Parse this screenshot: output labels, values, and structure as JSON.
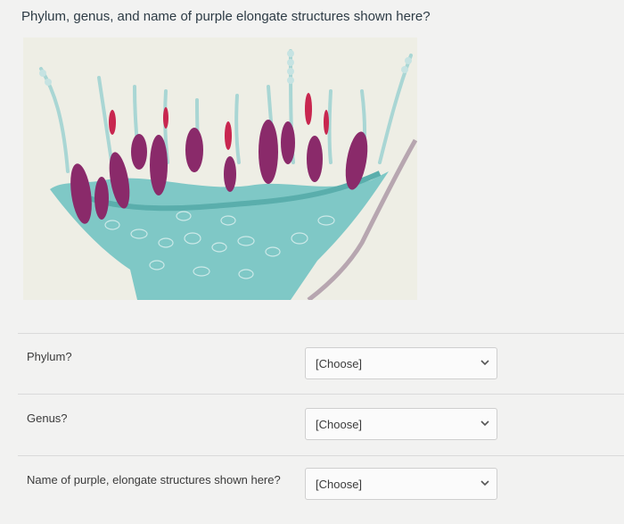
{
  "question": {
    "text": "Phylum, genus, and name of purple elongate structures shown here?"
  },
  "figure": {
    "icon": "micrograph-image",
    "colors": {
      "tissue": "#7fc8c6",
      "asci": "#8a2a6a",
      "background": "#eeeee5"
    }
  },
  "answers": [
    {
      "label": "Phylum?",
      "selected": "[Choose]"
    },
    {
      "label": "Genus?",
      "selected": "[Choose]"
    },
    {
      "label": "Name of purple, elongate structures shown here?",
      "selected": "[Choose]"
    }
  ]
}
